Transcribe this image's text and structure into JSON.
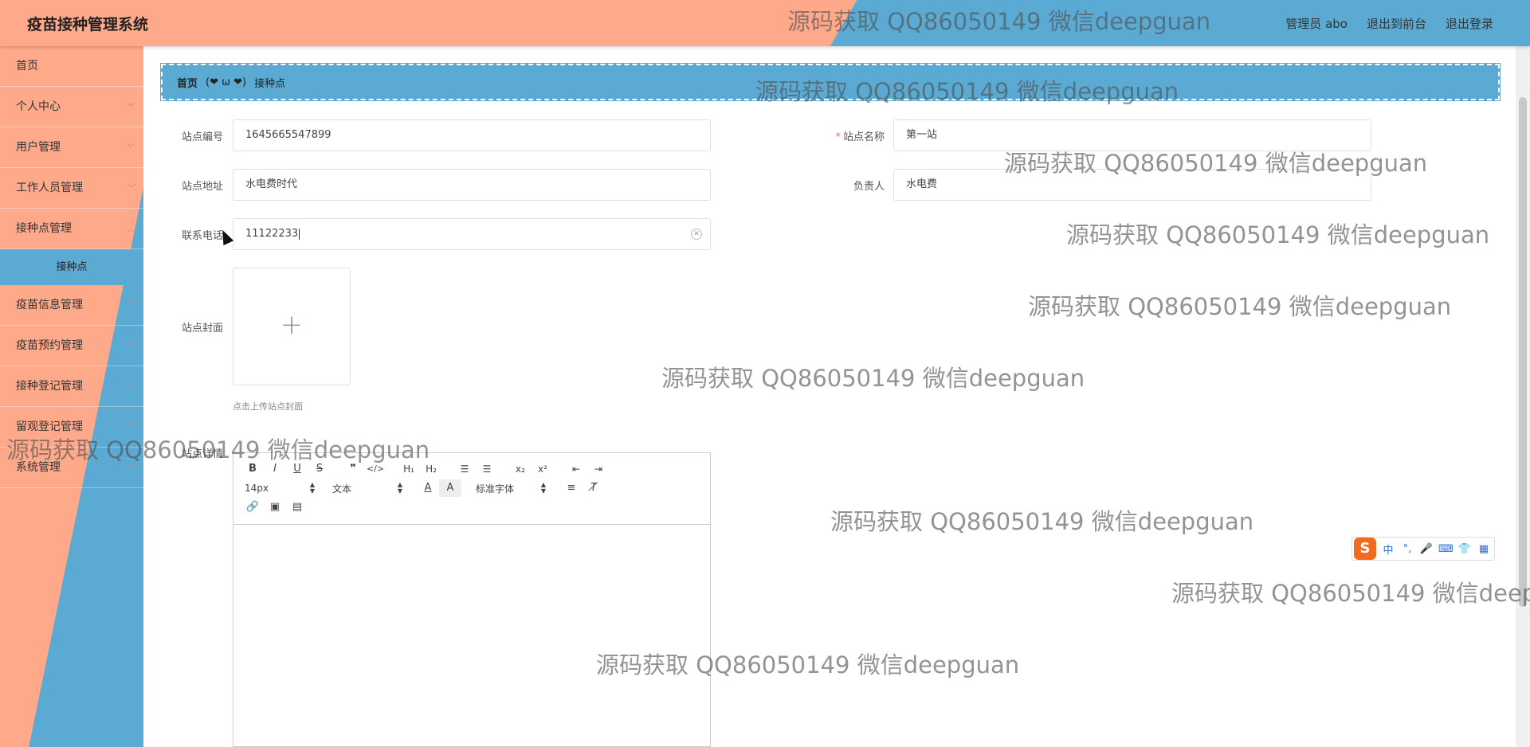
{
  "header": {
    "app_title": "疫苗接种管理系统",
    "user": "管理员 abo",
    "front_link": "退出到前台",
    "logout_link": "退出登录"
  },
  "sidebar": {
    "items": [
      {
        "label": "首页"
      },
      {
        "label": "个人中心"
      },
      {
        "label": "用户管理"
      },
      {
        "label": "工作人员管理"
      },
      {
        "label": "接种点管理"
      },
      {
        "label": "接种点"
      },
      {
        "label": "疫苗信息管理"
      },
      {
        "label": "疫苗预约管理"
      },
      {
        "label": "接种登记管理"
      },
      {
        "label": "留观登记管理"
      },
      {
        "label": "系统管理"
      }
    ]
  },
  "breadcrumb": {
    "home": "首页",
    "separator": "(❤ ω ❤)",
    "current": "接种点"
  },
  "form": {
    "site_no_label": "站点编号",
    "site_no_value": "1645665547899",
    "site_name_label": "站点名称",
    "site_name_value": "第一站",
    "address_label": "站点地址",
    "address_value": "水电费时代",
    "manager_label": "负责人",
    "manager_value": "水电费",
    "phone_label": "联系电话",
    "phone_value": "11122233",
    "cover_label": "站点封面",
    "cover_hint": "点击上传站点封面",
    "detail_label": "站点详情"
  },
  "editor": {
    "font_size": "14px",
    "paragraph": "文本",
    "font_family": "标准字体"
  },
  "ime": {
    "logo": "S",
    "mode": "中",
    "punct": "°,"
  },
  "watermark": "源码获取 QQ86050149 微信deepguan",
  "colors": {
    "salmon": "#ffa98b",
    "blue": "#5baad3"
  }
}
